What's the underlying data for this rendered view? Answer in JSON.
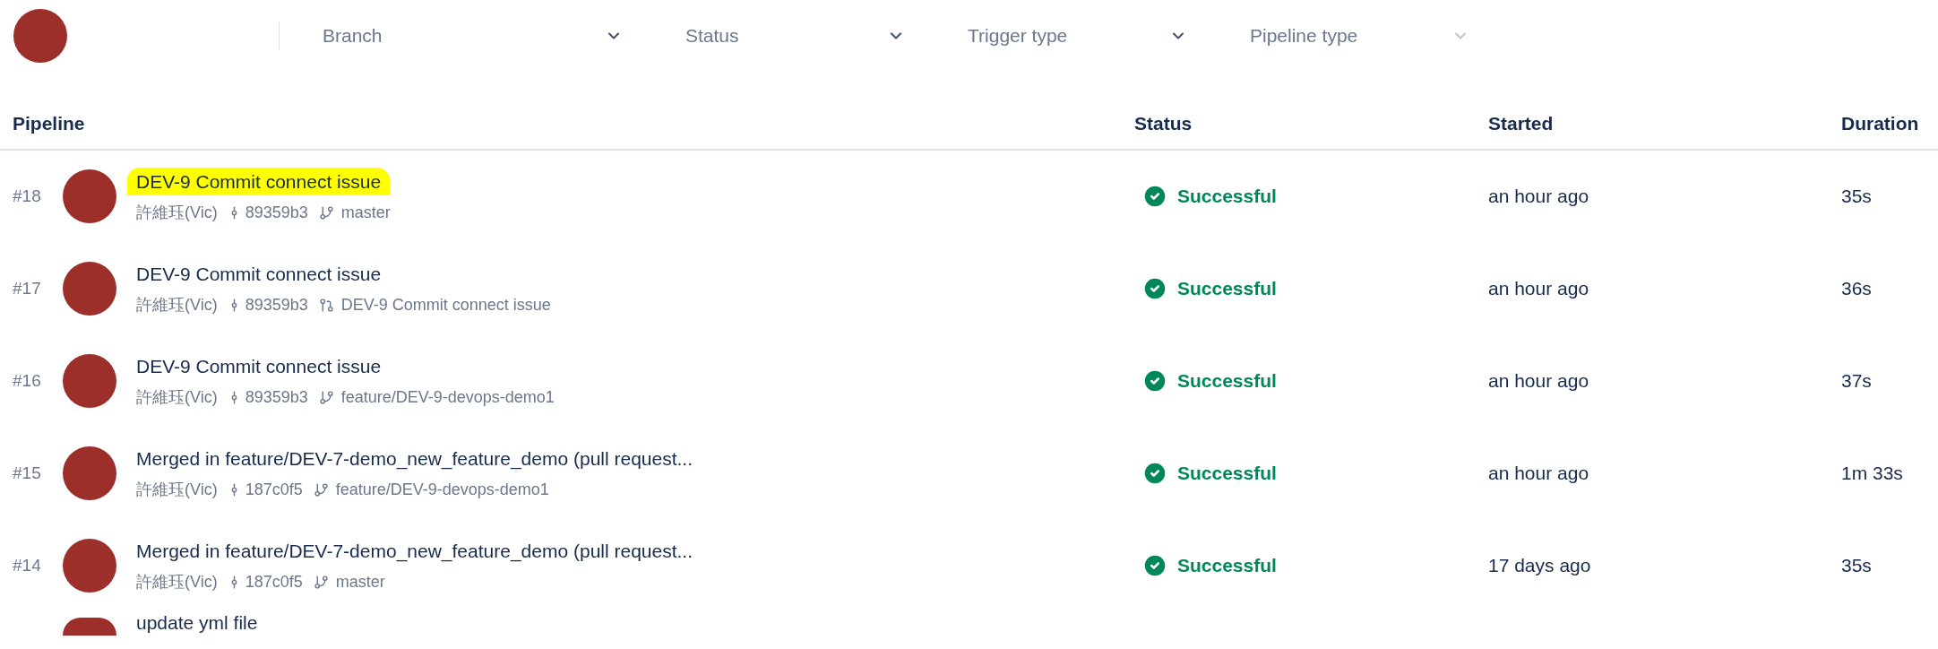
{
  "filters": [
    {
      "placeholder": "Branch",
      "disabled": false
    },
    {
      "placeholder": "Status",
      "disabled": false
    },
    {
      "placeholder": "Trigger type",
      "disabled": false
    },
    {
      "placeholder": "Pipeline type",
      "disabled": true
    }
  ],
  "table": {
    "columns": [
      "Pipeline",
      "Status",
      "Started",
      "Duration"
    ],
    "rows": [
      {
        "number": "#18",
        "title": "DEV-9 Commit connect issue",
        "highlighted": true,
        "author": "許維珏(Vic)",
        "commit": "89359b3",
        "kind": "branch",
        "ref": "master",
        "status": "Successful",
        "started": "an hour ago",
        "duration": "35s"
      },
      {
        "number": "#17",
        "title": "DEV-9 Commit connect issue",
        "highlighted": false,
        "author": "許維珏(Vic)",
        "commit": "89359b3",
        "kind": "pull_request",
        "ref": "DEV-9 Commit connect issue",
        "status": "Successful",
        "started": "an hour ago",
        "duration": "36s"
      },
      {
        "number": "#16",
        "title": "DEV-9 Commit connect issue",
        "highlighted": false,
        "author": "許維珏(Vic)",
        "commit": "89359b3",
        "kind": "branch",
        "ref": "feature/DEV-9-devops-demo1",
        "status": "Successful",
        "started": "an hour ago",
        "duration": "37s"
      },
      {
        "number": "#15",
        "title": "Merged in feature/DEV-7-demo_new_feature_demo (pull request...",
        "highlighted": false,
        "author": "許維珏(Vic)",
        "commit": "187c0f5",
        "kind": "branch",
        "ref": "feature/DEV-9-devops-demo1",
        "status": "Successful",
        "started": "an hour ago",
        "duration": "1m 33s"
      },
      {
        "number": "#14",
        "title": "Merged in feature/DEV-7-demo_new_feature_demo (pull request...",
        "highlighted": false,
        "author": "許維珏(Vic)",
        "commit": "187c0f5",
        "kind": "branch",
        "ref": "master",
        "status": "Successful",
        "started": "17 days ago",
        "duration": "35s"
      }
    ],
    "partial_row": {
      "title": "update yml file"
    }
  }
}
